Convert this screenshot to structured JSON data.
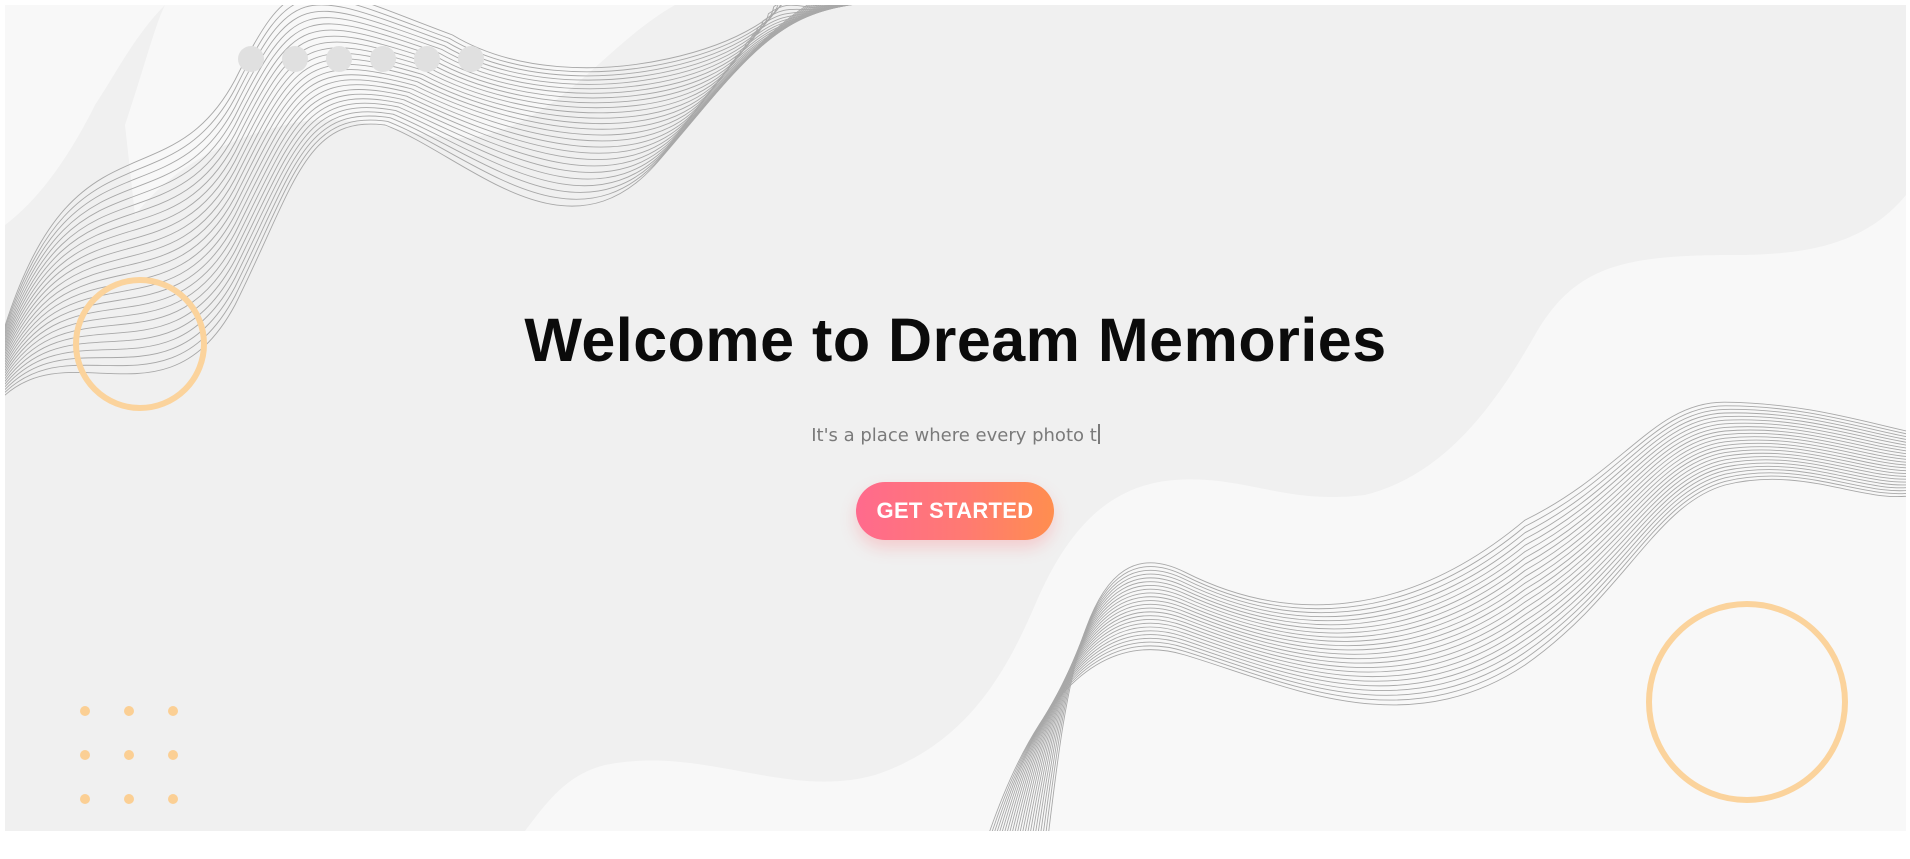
{
  "hero": {
    "title": "Welcome to Dream Memories",
    "subtitle": "It's a place where every photo t",
    "cta_label": "GET STARTED"
  },
  "colors": {
    "background": "#f0f0f0",
    "light_wave": "#f8f8f8",
    "accent_ring": "#fbd39c",
    "dot_orange": "#fbcf94",
    "dot_gray": "#e0e0e0",
    "button_gradient_start": "#ff6a8d",
    "button_gradient_end": "#ff8e4f",
    "title": "#0b0b0b",
    "subtitle": "#7a7a7a"
  }
}
